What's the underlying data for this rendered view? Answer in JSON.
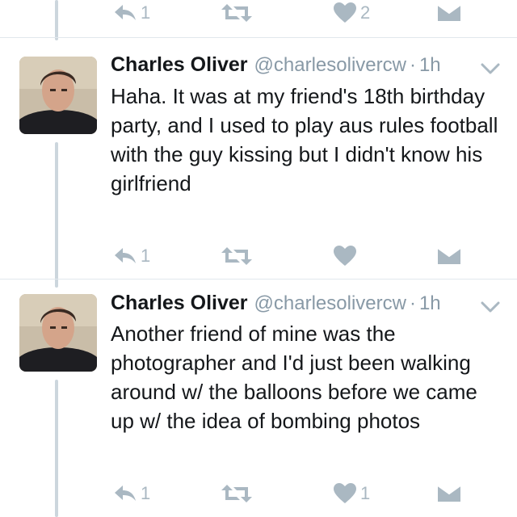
{
  "colors": {
    "action_icon": "#aab8c2",
    "thread_line": "#ccd6dd",
    "handle_text": "#8899a6",
    "body_text": "#14171a"
  },
  "top_actions": {
    "reply_count": "1",
    "like_count": "2"
  },
  "tweets": [
    {
      "author_name": "Charles Oliver",
      "handle": "@charlesolivercw",
      "separator": "·",
      "time": "1h",
      "text": "Haha. It was at my friend's 18th birthday party, and I used to play aus rules football with the guy kissing but I didn't know his girlfriend",
      "reply_count": "1",
      "like_count": ""
    },
    {
      "author_name": "Charles Oliver",
      "handle": "@charlesolivercw",
      "separator": "·",
      "time": "1h",
      "text": "Another friend of mine was the photographer and I'd just been walking around w/ the balloons before we came up w/ the idea of bombing photos",
      "reply_count": "1",
      "like_count": "1"
    }
  ],
  "icons": {
    "reply": "reply-icon",
    "retweet": "retweet-icon",
    "like": "heart-icon",
    "message": "envelope-icon",
    "menu": "chevron-down-icon"
  }
}
